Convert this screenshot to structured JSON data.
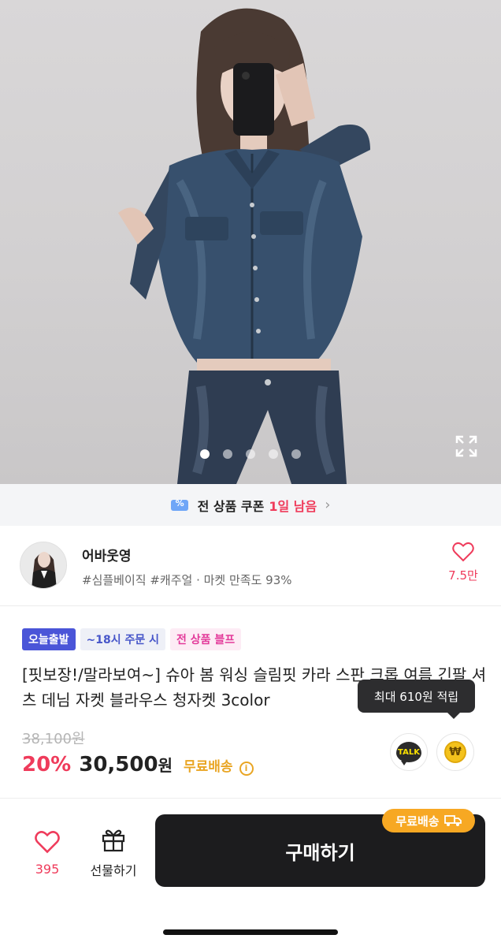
{
  "coupon": {
    "text": "전 상품 쿠폰",
    "highlight": "1일 남음",
    "chevron": "›"
  },
  "gallery": {
    "slide_count": 5,
    "active_index": 0,
    "description_icon": "expand-icon"
  },
  "seller": {
    "name": "어바웃영",
    "tags": "#심플베이직 #캐주얼 · 마켓 만족도 93%",
    "likes": "7.5만"
  },
  "product": {
    "badges": [
      "오늘출발",
      "~18시 주문 시",
      "전 상품 블프"
    ],
    "title": "[핏보장!/말라보여~] 슈아 봄 워싱 슬림핏 카라 스판 크롭 여름 긴팔 셔츠 데님 자켓 블라우스 청자켓 3color",
    "original_price": "38,100원",
    "discount": "20%",
    "price": "30,500",
    "currency": "원",
    "shipping": "무료배송",
    "info_icon": "i"
  },
  "tooltip": {
    "text": "최대 610원 적립"
  },
  "actions": {
    "talk_label": "TALK",
    "point_label": "₩"
  },
  "bottom_bar": {
    "like_count": "395",
    "gift_label": "선물하기",
    "buy_label": "구매하기",
    "ship_tag": "무료배송"
  },
  "colors": {
    "accent_red": "#ef3b5b",
    "shipping_orange": "#e9a523",
    "badge_blue": "#4a55d8",
    "buy_button": "#1c1c1e"
  }
}
